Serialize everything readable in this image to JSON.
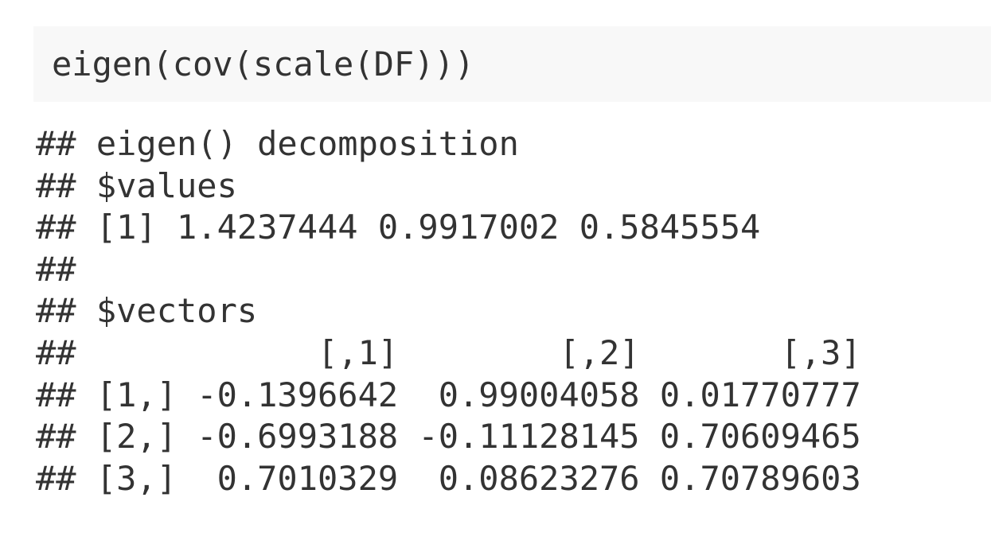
{
  "code": {
    "input": "eigen(cov(scale(DF)))"
  },
  "output": {
    "lines": [
      "## eigen() decomposition",
      "## $values",
      "## [1] 1.4237444 0.9917002 0.5845554",
      "## ",
      "## $vectors",
      "##            [,1]        [,2]       [,3]",
      "## [1,] -0.1396642  0.99004058 0.01770777",
      "## [2,] -0.6993188 -0.11128145 0.70609465",
      "## [3,]  0.7010329  0.08623276 0.70789603"
    ]
  },
  "colors": {
    "code_background": "#f8f8f8",
    "text": "#333333"
  }
}
